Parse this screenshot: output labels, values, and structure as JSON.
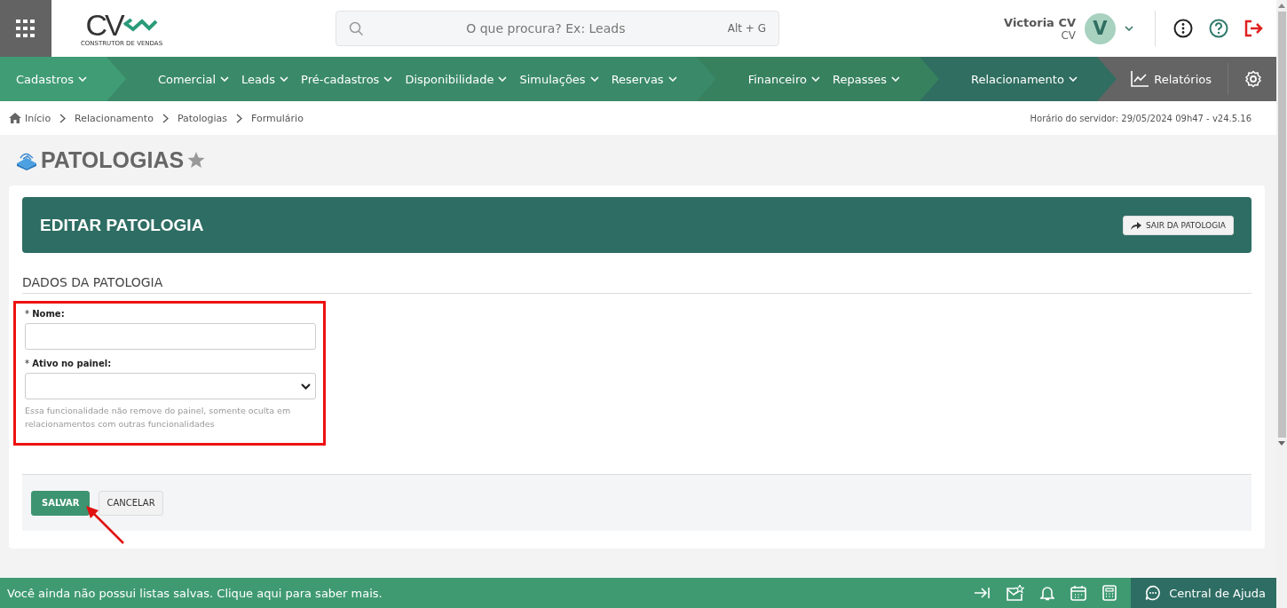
{
  "logo": {
    "mark": "CV",
    "tagline": "CONSTRUTOR DE VENDAS"
  },
  "search": {
    "placeholder": "O que procura? Ex: Leads",
    "shortcut": "Alt + G"
  },
  "user": {
    "name": "Victoria CV",
    "company": "CV",
    "initial": "V"
  },
  "nav": {
    "groups": [
      {
        "color": "#409c75",
        "items": [
          "Cadastros"
        ]
      },
      {
        "color": "#3a8a69",
        "items": [
          "Comercial",
          "Leads",
          "Pré-cadastros",
          "Disponibilidade",
          "Simulações",
          "Reservas"
        ]
      },
      {
        "color": "#37815f",
        "items": [
          "Financeiro",
          "Repasses"
        ]
      },
      {
        "color": "#2f6e60",
        "items": [
          "Relacionamento"
        ]
      }
    ],
    "reports": "Relatórios"
  },
  "breadcrumb": [
    "Início",
    "Relacionamento",
    "Patologias",
    "Formulário"
  ],
  "server_info": "Horário do servidor: 29/05/2024 09h47 - v24.5.16",
  "page_title": "PATOLOGIAS",
  "card": {
    "title": "EDITAR PATOLOGIA",
    "exit_button": "SAIR DA PATOLOGIA"
  },
  "section_title": "DADOS DA PATOLOGIA",
  "fields": [
    {
      "kind": "text",
      "required_mark": "*",
      "label": "Nome:"
    },
    {
      "kind": "select",
      "required_mark": "*",
      "label": "Ativo no painel:",
      "help": "Essa funcionalidade não remove do painel, somente oculta em relacionamentos com outras funcionalidades"
    }
  ],
  "actions": [
    "SALVAR",
    "CANCELAR"
  ],
  "footer": {
    "message": "Você ainda não possui listas salvas. Clique aqui para saber mais.",
    "help": "Central de Ajuda"
  }
}
